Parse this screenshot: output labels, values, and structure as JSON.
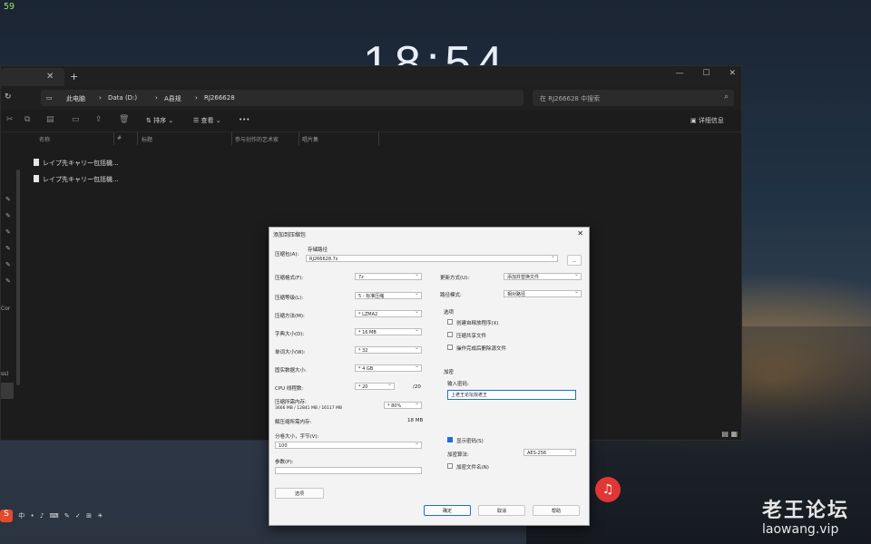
{
  "overlay": {
    "fps": "59"
  },
  "lockscreen": {
    "clock": "18:54"
  },
  "explorer": {
    "breadcrumb": [
      "此电脑",
      "Data (D:)",
      "A县规",
      "RJ266628"
    ],
    "search_placeholder": "在 RJ266628 中搜索",
    "toolbar": {
      "sort": "排序",
      "view": "查看",
      "more": "•••",
      "details": "详细信息"
    },
    "columns": [
      "名称",
      "#",
      "标题",
      "参与创作的艺术家",
      "唱片集"
    ],
    "files": [
      "レイプ先キャリー包括機...",
      "レイプ先キャリー包括機..."
    ],
    "side_text": [
      "Cor",
      "ss)"
    ]
  },
  "dialog": {
    "title": "添加到压缩包",
    "archive_label": "压缩包(A):",
    "archive_sub": "存储路径",
    "archive_value": "RJ266628.7z",
    "browse": "...",
    "left": [
      {
        "label": "压缩格式(F):",
        "value": "7z"
      },
      {
        "label": "压缩等级(L):",
        "value": "5 - 标准压缩"
      },
      {
        "label": "压缩方法(M):",
        "value": "* LZMA2"
      },
      {
        "label": "字典大小(D):",
        "value": "* 16 MB"
      },
      {
        "label": "单词大小(W):",
        "value": "* 32"
      },
      {
        "label": "固实数据大小:",
        "value": "* 4 GB"
      },
      {
        "label": "CPU 线程数:",
        "value": "* 20",
        "extra": "/20"
      }
    ],
    "memory_label": "压缩所需内存:",
    "memory_sub": "3666 MB / 12841 MB / 16117 MB",
    "memory_pct": "* 80%",
    "decomp_label": "解压缩所需内存:",
    "decomp_value": "18 MB",
    "split_label": "分卷大小，字节(V):",
    "split_value": "100",
    "params_label": "参数(P):",
    "options_btn": "选项",
    "right": {
      "update_label": "更新方式(U):",
      "update_value": "添加并替换文件",
      "path_label": "路径模式:",
      "path_value": "相对路径",
      "options_title": "选项",
      "opt1": "创建自释放程序(X)",
      "opt2": "压缩共享文件",
      "opt3": "操作完成后删除源文件",
      "encrypt_title": "加密",
      "password_label": "输入密码:",
      "password_value": "上老王论坛找老王",
      "show_password": "显示密码(S)",
      "enc_method_label": "加密算法:",
      "enc_method_value": "AES-256",
      "encrypt_names": "加密文件名(N)"
    },
    "buttons": {
      "ok": "确定",
      "cancel": "取消",
      "help": "帮助"
    }
  },
  "watermark": {
    "cn": "老王论坛",
    "en": "laowang.vip"
  },
  "taskbar": {
    "items": [
      "S",
      "中",
      "•",
      "♪",
      "⌨",
      "✎",
      "✓",
      "⊞",
      "☀"
    ]
  }
}
